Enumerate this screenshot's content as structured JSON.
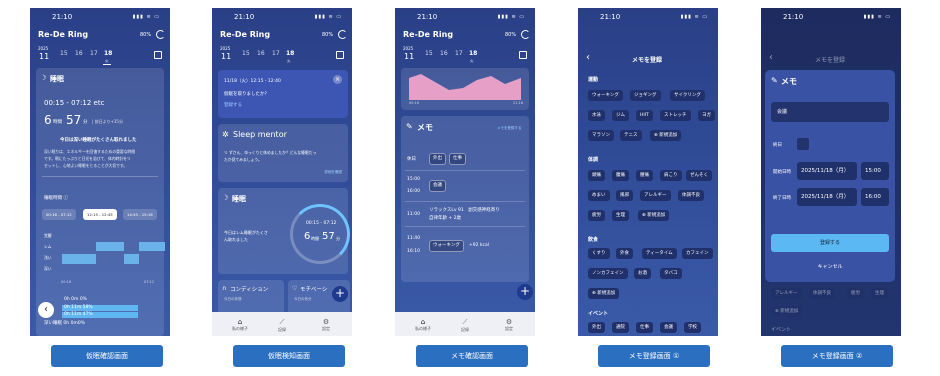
{
  "captions": [
    "仮眠確認画面",
    "仮眠検知画面",
    "メモ確認画面",
    "メモ登録画面 ①",
    "メモ登録画面 ②"
  ],
  "status": {
    "time": "21:10",
    "icons": "▮▮▮ ≋ ▭"
  },
  "app": {
    "name": "Re-De Ring",
    "battery": "80%",
    "year": "2025"
  },
  "dates": {
    "month": "11",
    "d1": "15",
    "d2": "16",
    "d3": "17",
    "d4": "18",
    "dow": "火"
  },
  "s1": {
    "section": "睡眠",
    "range": "00:15 - 07:12 etc",
    "hours": "6",
    "hunit": "時間",
    "mins": "57",
    "munit": "分",
    "note": "| 前日より+35分",
    "comment_title": "今日は深い睡眠がたくさん取れました",
    "comment": [
      "深い眠りは、エネルギーを回復するための重要な時間",
      "です。朝にたっぷりと日光を浴びて、体内時計をリ",
      "セットし、心地よい睡眠をとることが大切です。"
    ],
    "nap_label": "睡眠時間 ⓘ",
    "naps": [
      "00:16 - 07:12",
      "12:15 - 12:45",
      "14:55 - 15:16"
    ],
    "stages": [
      "覚醒",
      "レム",
      "浅い",
      "深い"
    ],
    "times": [
      "00:16",
      "07:12"
    ],
    "legend": [
      "0h 0m 0%",
      "0h 11m 58%",
      "0h 11m 47%",
      "深い睡眠  0h 0m0%"
    ]
  },
  "s2": {
    "notice_time": "11/18（火）12:15 - 12:40",
    "notice_q": "仮眠を取りましたか？",
    "notice_link": "登録する",
    "mentor": "Sleep mentor",
    "mentor_text": [
      "リ ずさん、ゆっくりと休めましたか？どんな睡眠だっ",
      "たか見てみましょう。"
    ],
    "mentor_link": "詳細を確認",
    "sleep": "睡眠",
    "sleep_text": [
      "今日はレム睡眠がたくさ",
      "ん取れました"
    ],
    "ring_range": "00:15 - 07:12",
    "hours": "6",
    "hunit": "時間",
    "mins": "57",
    "munit": "分",
    "cond": "コンディション",
    "cond_sub": "今日の状態",
    "mot": "モチベーシ",
    "mot_sub": "今日の気分"
  },
  "tabs": [
    "私の様子",
    "記録",
    "設定"
  ],
  "s3": {
    "memo": "メモ",
    "memo_link": "メモを登録する",
    "times": [
      "00:16",
      "21:16"
    ],
    "r1_time": "休日",
    "r1_chips": [
      "外出",
      "仕事"
    ],
    "r2_time": "15:00",
    "r2_time2": "16:00",
    "r2_chip": "会議",
    "r3_time": "11:00",
    "r3_text": [
      "リラックスLv 91　副交感神経寄り",
      "自律年齢 + 2歳"
    ],
    "r4_time": "11:40",
    "r4_time2": "16:10",
    "r4_chip": "ウォーキング",
    "r4_text": "+92 kcal"
  },
  "s4": {
    "title": "メモを登録",
    "cat1": "運動",
    "ex": [
      "ウォーキング",
      "ジョギング",
      "サイクリング",
      "水泳",
      "ジム",
      "HIIT",
      "ストレッチ",
      "ヨガ",
      "マラソン",
      "テニス",
      "新規追加"
    ],
    "cat2": "体調",
    "cond": [
      "頭痛",
      "腹痛",
      "腰痛",
      "肩こり",
      "ぜんそく",
      "めまい",
      "風邪",
      "アレルギー",
      "体調不良",
      "疲労",
      "生理",
      "新規追加"
    ],
    "cat3": "飲食",
    "food": [
      "くすり",
      "外食",
      "ティータイム",
      "カフェイン",
      "ノンカフェイン",
      "お酒",
      "タバコ",
      "新規追加"
    ],
    "cat4": "イベント",
    "events": [
      "外出",
      "通院",
      "仕事",
      "会議",
      "学校"
    ]
  },
  "s5": {
    "header": "メモを登録",
    "title": "メモ",
    "name": "会議",
    "allday": "終日",
    "start_label": "開始日時",
    "end_label": "終了日時",
    "start_date": "2025/11/18（月）",
    "start_time": "15:00",
    "end_date": "2025/11/18（月）",
    "end_time": "16:00",
    "submit": "登録する",
    "cancel": "キャンセル",
    "bg_chips": [
      "アレルギー",
      "体調不良",
      "疲労",
      "生理"
    ],
    "bg_new": "新規追加",
    "bg_cat": "イベント"
  }
}
